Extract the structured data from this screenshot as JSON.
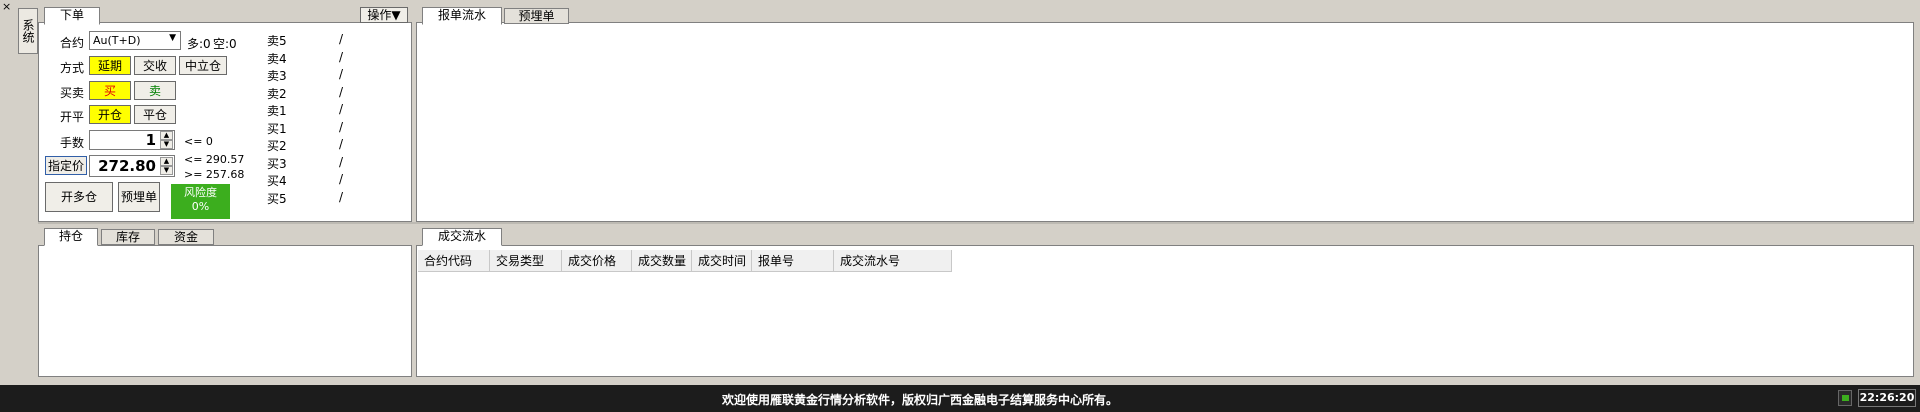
{
  "sys_tab": {
    "label": "系统"
  },
  "top_left": {
    "tab": "下单",
    "ops_label": "操作▼",
    "contract": {
      "label": "合约",
      "value": "Au(T+D)",
      "long": "多:0",
      "short": "空:0"
    },
    "mode": {
      "label": "方式",
      "options": [
        "延期",
        "交收",
        "中立仓"
      ]
    },
    "side": {
      "label": "买卖",
      "buy": "买",
      "sell": "卖"
    },
    "openclose": {
      "label": "开平",
      "open": "开仓",
      "close": "平仓"
    },
    "qty": {
      "label": "手数",
      "value": "1",
      "limit": "<= 0"
    },
    "price": {
      "label": "指定价",
      "value": "272.80",
      "upper": "<= 290.57",
      "lower": ">= 257.68"
    },
    "actions": {
      "open_long": "开多仓",
      "preorder": "预埋单"
    },
    "risk": {
      "title": "风险度",
      "value": "0%"
    },
    "book": [
      {
        "label": "卖5",
        "value": "/"
      },
      {
        "label": "卖4",
        "value": "/"
      },
      {
        "label": "卖3",
        "value": "/"
      },
      {
        "label": "卖2",
        "value": "/"
      },
      {
        "label": "卖1",
        "value": "/"
      },
      {
        "label": "买1",
        "value": "/"
      },
      {
        "label": "买2",
        "value": "/"
      },
      {
        "label": "买3",
        "value": "/"
      },
      {
        "label": "买4",
        "value": "/"
      },
      {
        "label": "买5",
        "value": "/"
      }
    ]
  },
  "top_right": {
    "tabs": [
      "报单流水",
      "预埋单"
    ]
  },
  "bottom_left": {
    "tabs": [
      "持仓",
      "库存",
      "资金"
    ]
  },
  "bottom_right": {
    "tab": "成交流水",
    "columns": [
      "合约代码",
      "交易类型",
      "成交价格",
      "成交数量",
      "成交时间",
      "报单号",
      "成交流水号"
    ]
  },
  "status": {
    "message": "欢迎使用雁联黄金行情分析软件，版权归广西金融电子结算服务中心所有。",
    "clock": "22:26:20"
  },
  "colors": {
    "risk_bg": "#3cae1e",
    "status_bg": "#1c1c1c",
    "highlight": "#ffff00"
  }
}
